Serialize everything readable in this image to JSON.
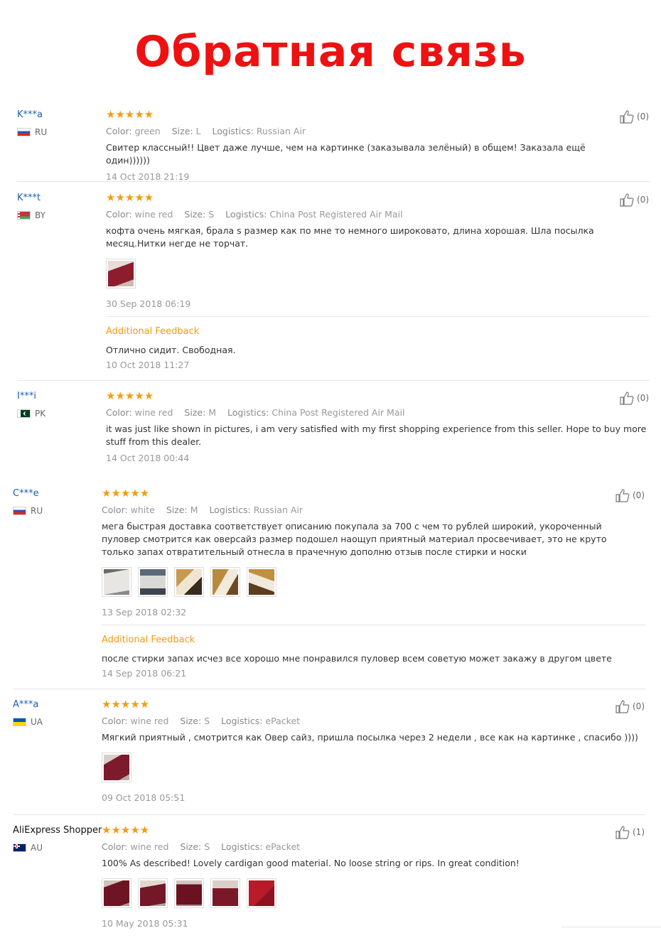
{
  "title": "Обратная связь",
  "labels": {
    "color": "Color:",
    "size": "Size:",
    "logistics": "Logistics:",
    "additional": "Additional Feedback"
  },
  "colors": {
    "title": "#ee1111",
    "stars": "#f39c12",
    "buyer_link": "#1a5fb4",
    "additional": "#f29b10"
  },
  "reviews": [
    {
      "buyer": "K***a",
      "country": "RU",
      "flag_icon": "flag-ru-icon",
      "stars": "★★★★★",
      "rating": 5,
      "color": "green",
      "size": "L",
      "logistics": "Russian Air",
      "text": "Свитер классный!! Цвет даже лучше, чем на картинке (заказывала зелёный) в общем! Заказала ещё один))))))",
      "date": "14 Oct 2018 21:19",
      "helpful": "(0)"
    },
    {
      "buyer": "K***t",
      "country": "BY",
      "flag_icon": "flag-by-icon",
      "stars": "★★★★★",
      "rating": 5,
      "color": "wine red",
      "size": "S",
      "logistics": "China Post Registered Air Mail",
      "text": "кофта очень мягкая, брала s размер как по мне то немного широковато, длина хорошая. Шла посылка месяц.Нитки негде не торчат.",
      "date": "30 Sep 2018 06:19",
      "helpful": "(0)",
      "additional_text": "Отлично сидит. Свободная.",
      "additional_date": "10 Oct 2018 11:27"
    },
    {
      "buyer": "I***i",
      "country": "PK",
      "flag_icon": "flag-pk-icon",
      "stars": "★★★★★",
      "rating": 5,
      "color": "wine red",
      "size": "M",
      "logistics": "China Post Registered Air Mail",
      "text": "it was just like shown in pictures, i am very satisfied with my first shopping experience from this seller. Hope to buy more stuff from this dealer.",
      "date": "14 Oct 2018 00:44",
      "helpful": "(0)"
    },
    {
      "buyer": "C***e",
      "country": "RU",
      "flag_icon": "flag-ru-icon",
      "stars": "★★★★★",
      "rating": 5,
      "color": "white",
      "size": "M",
      "logistics": "Russian Air",
      "text": "мега быстрая доставка соответствует описанию покупала за 700 с чем то рублей широкий, укороченный пуловер смотрится как оверсайз размер подошел наощуп приятный материал просвечивает, это не круто только запах отвратительный отнесла в прачечную дополню отзыв после стирки и носки",
      "date": "13 Sep 2018 02:32",
      "helpful": "(0)",
      "additional_text": "после стирки запах исчез все хорошо мне понравился пуловер всем советую может закажу в другом цвете",
      "additional_date": "14 Sep 2018 06:21"
    },
    {
      "buyer": "A***a",
      "country": "UA",
      "flag_icon": "flag-ua-icon",
      "stars": "★★★★★",
      "rating": 5,
      "color": "wine red",
      "size": "S",
      "logistics": "ePacket",
      "text": "Мягкий приятный , смотрится как Овер сайз, пришла посылка через 2 недели , все как на картинке , спасибо ))))",
      "date": "09 Oct 2018 05:51",
      "helpful": "(0)"
    },
    {
      "buyer": "AliExpress Shopper",
      "country": "AU",
      "flag_icon": "flag-au-icon",
      "stars": "★★★★★",
      "rating": 5,
      "color": "wine red",
      "size": "S",
      "logistics": "ePacket",
      "text": "100% As described! Lovely cardigan good material. No loose string or rips. In great condition!",
      "date": "10 May 2018 05:31",
      "helpful": "(1)"
    }
  ]
}
